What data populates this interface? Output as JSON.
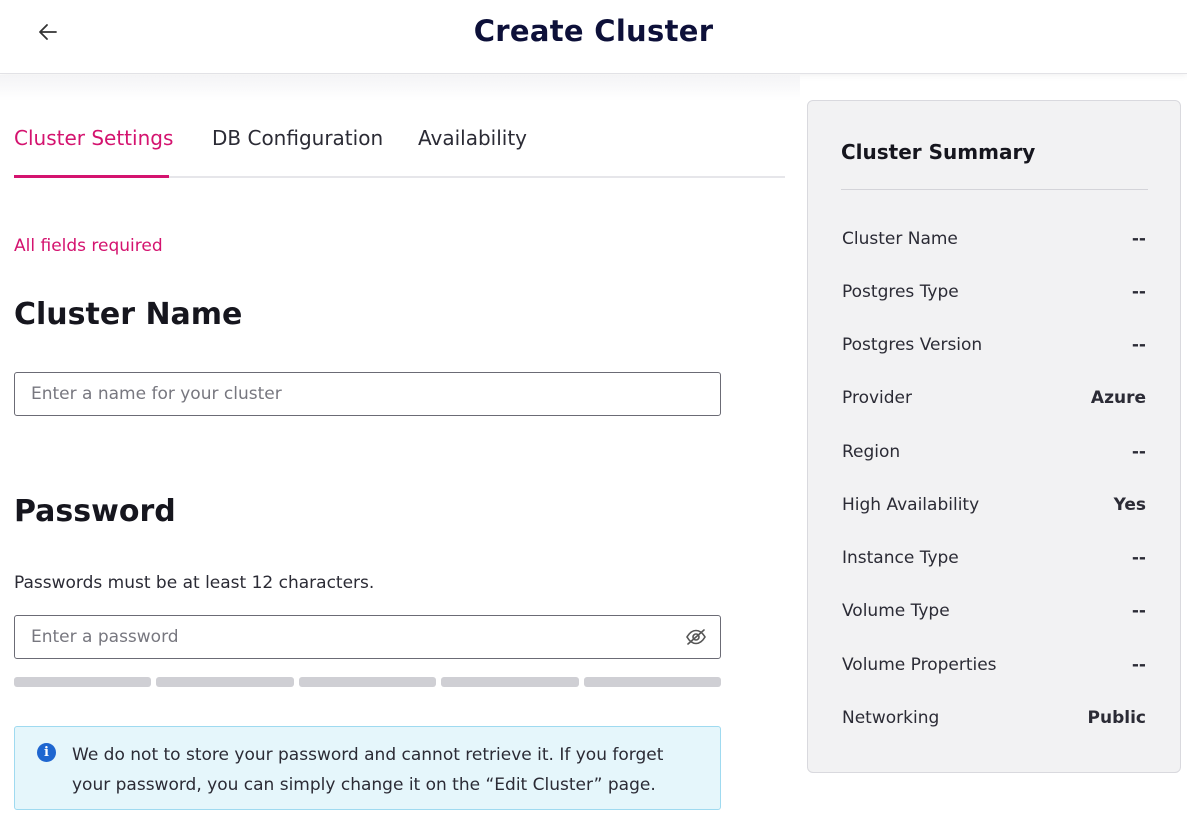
{
  "header": {
    "title": "Create Cluster",
    "back_icon": "arrow-left-icon"
  },
  "tabs": [
    {
      "label": "Cluster Settings",
      "active": true
    },
    {
      "label": "DB Configuration",
      "active": false
    },
    {
      "label": "Availability",
      "active": false
    }
  ],
  "form": {
    "required_note": "All fields required",
    "cluster_name_heading": "Cluster Name",
    "cluster_name_placeholder": "Enter a name for your cluster",
    "cluster_name_value": "",
    "password_heading": "Password",
    "password_hint": "Passwords must be at least 12 characters.",
    "password_placeholder": "Enter a password",
    "password_value": "",
    "password_toggle_icon": "eye-off-icon",
    "password_strength_segments": 5,
    "password_strength_filled": 0,
    "info_icon": "info-icon",
    "info_message": "We do not to store your password and cannot retrieve it. If you forget your password, you can simply change it on the “Edit Cluster” page."
  },
  "summary": {
    "title": "Cluster Summary",
    "rows": [
      {
        "label": "Cluster Name",
        "value": "--"
      },
      {
        "label": "Postgres Type",
        "value": "--"
      },
      {
        "label": "Postgres Version",
        "value": "--"
      },
      {
        "label": "Provider",
        "value": "Azure"
      },
      {
        "label": "Region",
        "value": "--"
      },
      {
        "label": "High Availability",
        "value": "Yes"
      },
      {
        "label": "Instance Type",
        "value": "--"
      },
      {
        "label": "Volume Type",
        "value": "--"
      },
      {
        "label": "Volume Properties",
        "value": "--"
      },
      {
        "label": "Networking",
        "value": "Public"
      }
    ]
  },
  "colors": {
    "accent": "#d4136f",
    "title": "#0d1039",
    "info_bg": "#e5f6fb",
    "info_icon": "#1e66d0",
    "summary_bg": "#f2f2f3"
  }
}
